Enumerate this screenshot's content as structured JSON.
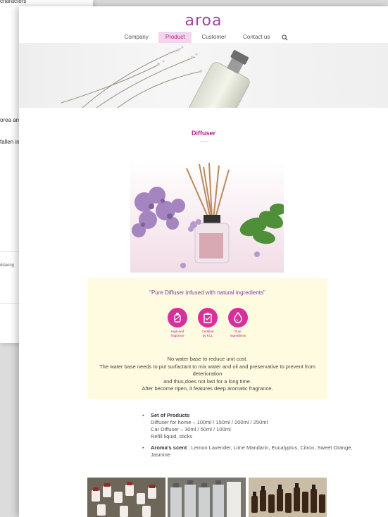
{
  "background_window": {
    "fragments": [
      "characters",
      "orea and",
      "fallen in",
      "ddaeng"
    ]
  },
  "header": {
    "logo_text": "aroa",
    "nav": [
      {
        "label": "Company",
        "active": false
      },
      {
        "label": "Product",
        "active": true
      },
      {
        "label": "Customer",
        "active": false
      },
      {
        "label": "Contact us",
        "active": false
      }
    ]
  },
  "product": {
    "title": "Diffuser",
    "tagline": "\"Pure Diffuser infused with natural ingredients\"",
    "badges": [
      {
        "line1": "High-end",
        "line2": "fragrance",
        "icon": "bottle-icon"
      },
      {
        "line1": "Certified",
        "line2": "by KCL",
        "icon": "clipboard-check-icon"
      },
      {
        "line1": "Pure",
        "line2": "ingredients",
        "icon": "drop-icon"
      }
    ],
    "description": [
      "No water base to reduce unit cost.",
      "The water base needs to put surfactant to mix water and oil and preservative to prevent from deterioration",
      "and thus,does not last for a long time.",
      "After become ripen, it features deep aromatic fragrance."
    ],
    "set_title": "Set of Products",
    "set_lines": [
      "Diffuser for home – 100ml / 150ml / 200ml / 250ml",
      "Car Diffuser – 30ml / 50ml / 100ml",
      "Refill liquid, sticks"
    ],
    "scent_title": "Aroma's scent",
    "scent_text": " : Lemon Lavender, Lime Mandarin, Eucalyptus, Citron, Sweet Orange, Jasmine"
  },
  "colors": {
    "brand": "#a4449b",
    "accent": "#b41e8c",
    "badge": "#d82f9a",
    "panel": "#fffbe0"
  }
}
